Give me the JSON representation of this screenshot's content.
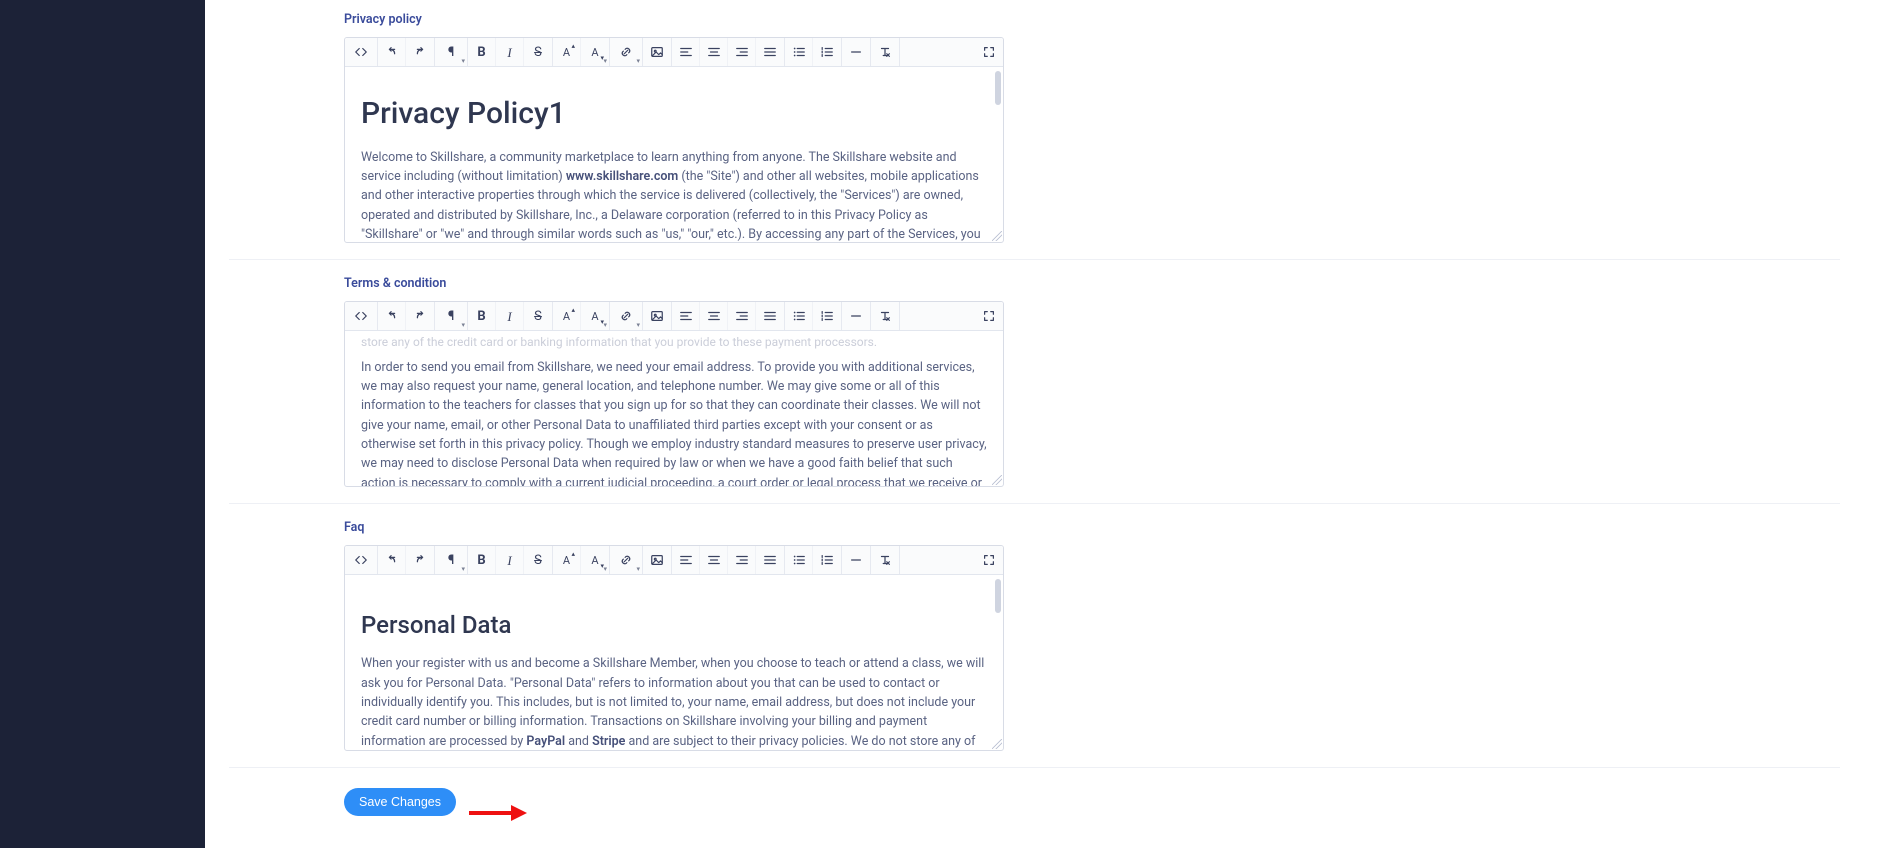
{
  "sections": {
    "privacy_label": "Privacy policy",
    "terms_label": "Terms & condition",
    "faq_label": "Faq"
  },
  "privacy": {
    "heading": "Privacy Policy1",
    "para1_a": "Welcome to Skillshare, a community marketplace to learn anything from anyone. The Skillshare website and service including (without limitation) ",
    "site_bold": "www.skillshare.com",
    "para1_b": " (the \"Site\") and other all websites, mobile applications and other interactive properties through which the service is delivered (collectively, the \"Services\") are owned, operated and distributed by Skillshare, Inc., a Delaware corporation (referred to in this Privacy Policy as \"Skillshare\" or \"we\" and through similar words such as \"us,\" \"our,\" etc.). By accessing any part of the Services, you are agreeing to the terms and conditions described below (this \"Privacy Policy\") and the terms and conditions of our terms of service (the \"Terms of Service\"). If you do not agree to any of these terms, you should not use the Services. This Privacy Policy applies to"
  },
  "terms": {
    "partial_top": "store any of the credit card or banking information that you provide to these payment processors.",
    "para": "In order to send you email from Skillshare, we need your email address. To provide you with additional services, we may also request your name, general location, and telephone number. We may give some or all of this information to the teachers for classes that you sign up for so that they can coordinate their classes. We will not give your name, email, or other Personal Data to unaffiliated third parties except with your consent or as otherwise set forth in this privacy policy. Though we employ industry standard measures to preserve user privacy, we may need to disclose Personal Data when required by law or when we have a good faith belief that such action is necessary to comply with a current judicial proceeding, a court order or legal process that we receive or to protect our interests or the safety of others. In addition, we may provide Personal Data to employees, consultants or other business or persons for the purpose of processing such information on our behalf. In such circumstances, we require that these parties agree to protect the confidentiality of such information and to comply with the terms of this Privacy Policy. We may use your Personal Data to operate, improve, understand and personalize our Services."
  },
  "faq": {
    "heading": "Personal Data",
    "para_a": "When your register with us and become a Skillshare Member, when you choose to teach or attend a class, we will ask you for Personal Data. \"Personal Data\" refers to information about you that can be used to contact or individually identify you. This includes, but is not limited to, your name, email address, but does not include your credit card number or billing information. Transactions on Skillshare involving your billing and payment information are processed by ",
    "paypal": "PayPal",
    "and": " and ",
    "stripe": "Stripe",
    "para_b": " and are subject to their privacy policies. We do not store any of the credit card or banking information that you provide to these payment processors."
  },
  "save_label": "Save Changes",
  "toolbar_labels": {
    "bold": "B",
    "italic": "I",
    "strike": "S",
    "para": "¶",
    "fontA1": "A",
    "fontA2": "A"
  },
  "toolbar_icons": [
    "code-icon",
    "undo-icon",
    "redo-icon",
    "paragraph-icon",
    "bold-icon",
    "italic-icon",
    "strikethrough-icon",
    "font-size-up-icon",
    "font-size-down-icon",
    "link-icon",
    "image-icon",
    "align-left-icon",
    "align-center-icon",
    "align-right-icon",
    "align-justify-icon",
    "list-ul-icon",
    "list-ol-icon",
    "horizontal-rule-icon",
    "clear-format-icon",
    "fullscreen-icon"
  ]
}
